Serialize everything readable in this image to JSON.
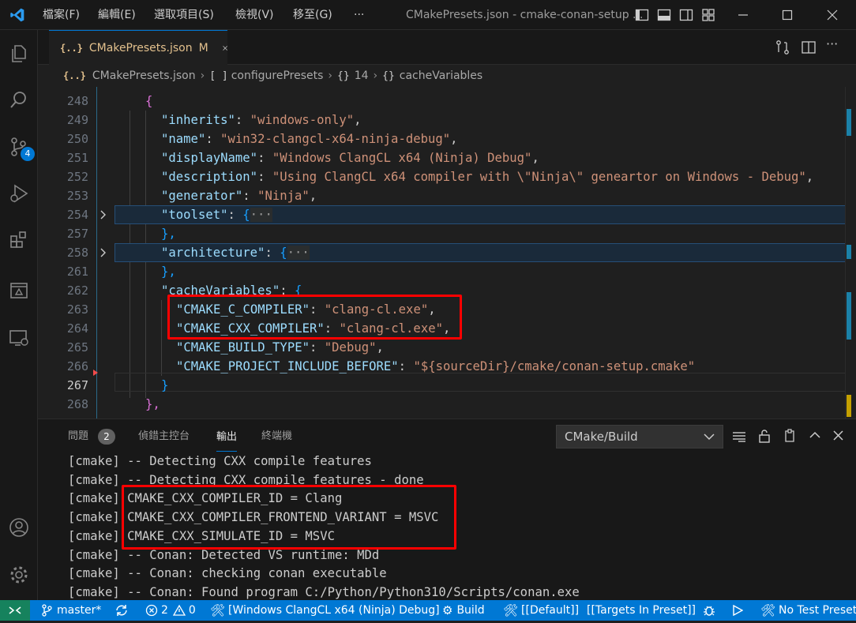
{
  "titlebar": {
    "menus": [
      "檔案(F)",
      "編輯(E)",
      "選取項目(S)",
      "檢視(V)",
      "移至(G)",
      "···"
    ],
    "title": "CMakePresets.json - cmake-conan-setup ..."
  },
  "activity": {
    "items": [
      "explorer-icon",
      "search-icon",
      "source-control-icon",
      "run-debug-icon",
      "extensions-icon",
      "remote-explorer-icon",
      "remote-icon"
    ],
    "scm_badge": "4",
    "bottom": [
      "account-icon",
      "settings-gear-icon"
    ]
  },
  "tab": {
    "label": "CMakePresets.json",
    "modified": "M",
    "icon": "{..}"
  },
  "breadcrumb": {
    "file": "CMakePresets.json",
    "items": [
      "configurePresets",
      "14",
      "cacheVariables"
    ]
  },
  "editor": {
    "line_numbers": [
      "248",
      "249",
      "250",
      "251",
      "252",
      "253",
      "254",
      "257",
      "258",
      "261",
      "262",
      "263",
      "264",
      "265",
      "266",
      "267",
      "268"
    ],
    "current_line": "267",
    "lines": {
      "l248_brace": "{",
      "l249_key": "\"inherits\"",
      "l249_val": "\"windows-only\"",
      "l250_key": "\"name\"",
      "l250_val": "\"win32-clangcl-x64-ninja-debug\"",
      "l251_key": "\"displayName\"",
      "l251_val": "\"Windows ClangCL x64 (Ninja) Debug\"",
      "l252_key": "\"description\"",
      "l252_val": "\"Using ClangCL x64 compiler with \\\"Ninja\\\" geneartor on Windows - Debug\"",
      "l253_key": "\"generator\"",
      "l253_val": "\"Ninja\"",
      "l254_key": "\"toolset\"",
      "l254_fold": "···",
      "l257": "},",
      "l258_key": "\"architecture\"",
      "l258_fold": "···",
      "l261": "},",
      "l262_key": "\"cacheVariables\"",
      "l263_key": "\"CMAKE_C_COMPILER\"",
      "l263_val": "\"clang-cl.exe\"",
      "l264_key": "\"CMAKE_CXX_COMPILER\"",
      "l264_val": "\"clang-cl.exe\"",
      "l265_key": "\"CMAKE_BUILD_TYPE\"",
      "l265_val": "\"Debug\"",
      "l266_key": "\"CMAKE_PROJECT_INCLUDE_BEFORE\"",
      "l266_val": "\"${sourceDir}/cmake/conan-setup.cmake\"",
      "l267": "}",
      "l268": "},"
    }
  },
  "panel": {
    "tabs": [
      "問題",
      "偵錯主控台",
      "輸出",
      "終端機"
    ],
    "problems_count": "2",
    "active_tab": "輸出",
    "output_channel": "CMake/Build",
    "output_lines": [
      "[cmake] -- Detecting CXX compile features",
      "[cmake] -- Detecting CXX compile features - done",
      "[cmake] CMAKE_CXX_COMPILER_ID = Clang",
      "[cmake] CMAKE_CXX_COMPILER_FRONTEND_VARIANT = MSVC",
      "[cmake] CMAKE_CXX_SIMULATE_ID = MSVC",
      "[cmake] -- Conan: Detected VS runtime: MDd",
      "[cmake] -- Conan: checking conan executable",
      "[cmake] -- Conan: Found program C:/Python/Python310/Scripts/conan.exe"
    ]
  },
  "statusbar": {
    "remote": "><",
    "branch": "master*",
    "errors": "2",
    "warnings": "0",
    "kit": "[Windows ClangCL x64 (Ninja) Debug]",
    "build": "Build",
    "default_target": "[[Default]]",
    "targets_in_preset": "[[Targets In Preset]]",
    "test_preset": "No Test Preset"
  },
  "colors": {
    "accent": "#0078d4",
    "highlight_box": "#ff0000",
    "string": "#ce9178",
    "key": "#9cdcfe"
  }
}
